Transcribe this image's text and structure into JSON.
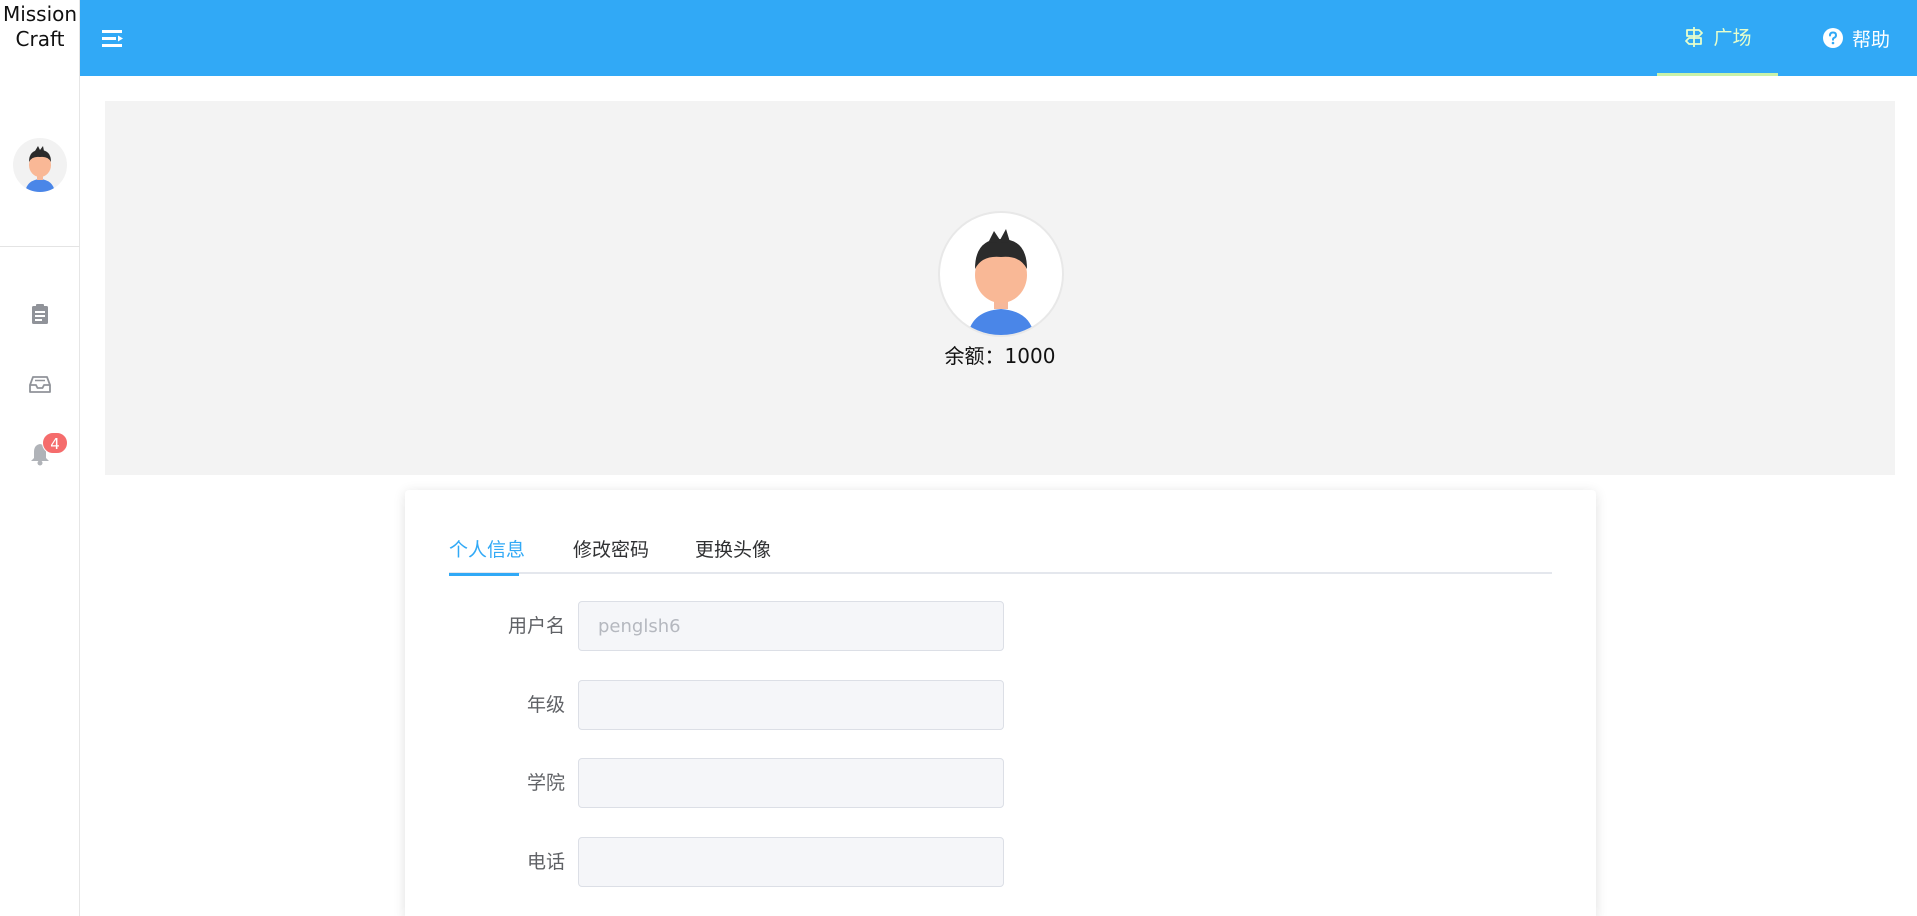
{
  "app": {
    "logo_line1": "Mission",
    "logo_line2": "Craft"
  },
  "sidebar": {
    "items": [
      {
        "name": "tasks",
        "icon": "clipboard-icon"
      },
      {
        "name": "inbox",
        "icon": "inbox-icon"
      },
      {
        "name": "notifications",
        "icon": "bell-icon",
        "badge": "4"
      }
    ]
  },
  "header": {
    "nav": [
      {
        "label": "广场",
        "icon": "signpost-icon",
        "active": true
      },
      {
        "label": "帮助",
        "icon": "question-circle-icon",
        "active": false
      }
    ]
  },
  "banner": {
    "balance": "余额：1000"
  },
  "tabs": [
    {
      "label": "个人信息",
      "active": true
    },
    {
      "label": "修改密码",
      "active": false
    },
    {
      "label": "更换头像",
      "active": false
    }
  ],
  "form": {
    "username": {
      "label": "用户名",
      "placeholder": "penglsh6",
      "value": ""
    },
    "grade": {
      "label": "年级",
      "placeholder": "",
      "value": ""
    },
    "college": {
      "label": "学院",
      "placeholder": "",
      "value": ""
    },
    "phone": {
      "label": "电话",
      "placeholder": "",
      "value": ""
    }
  },
  "colors": {
    "primary": "#31a9f6",
    "badge": "#f56c6c",
    "banner_bg": "#f3f3f3"
  }
}
